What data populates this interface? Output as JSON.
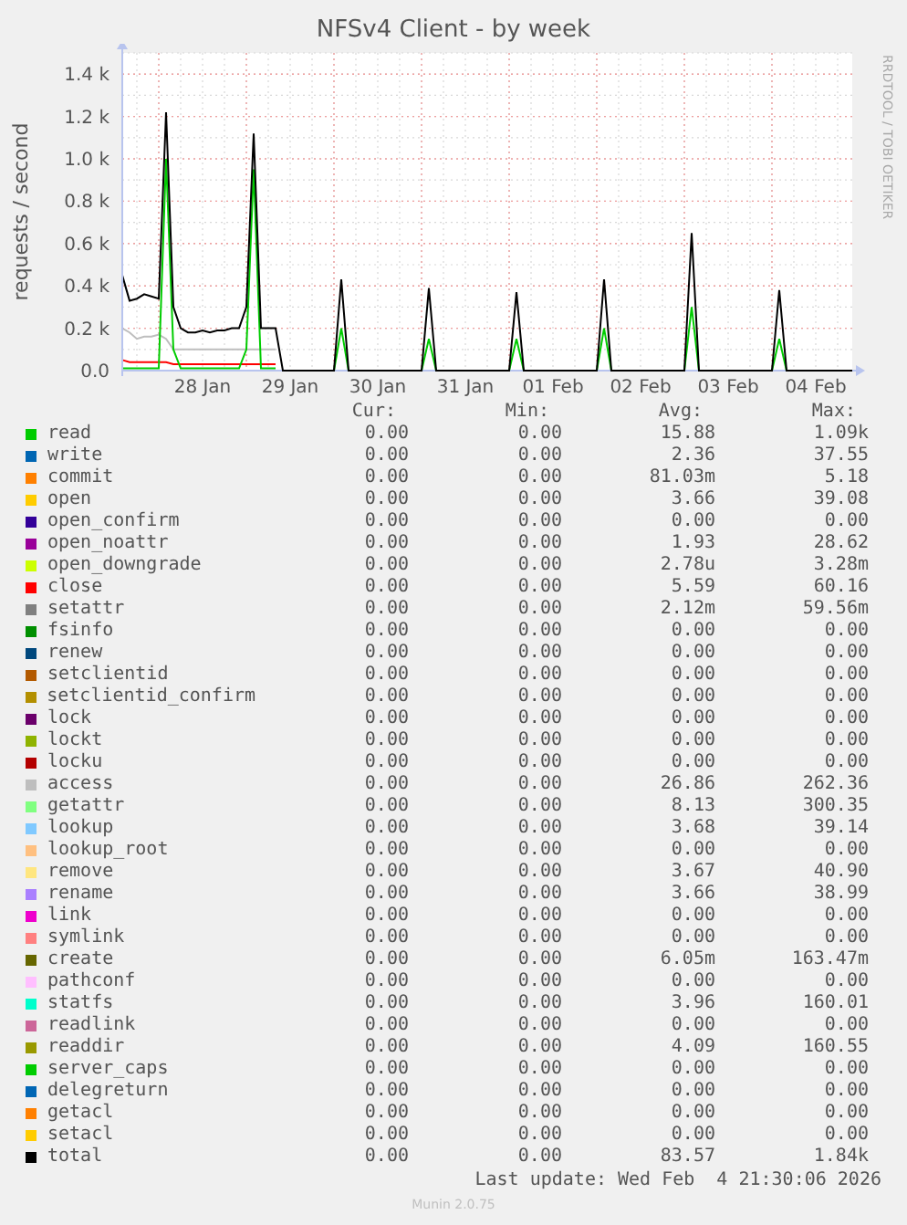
{
  "title": "NFSv4 Client - by week",
  "credit": "RRDTOOL / TOBI OETIKER",
  "chart_data": {
    "type": "line",
    "grid": true,
    "ylabel": "requests / second",
    "ylim": [
      0,
      1500
    ],
    "categories": [
      null,
      null,
      null,
      null,
      null,
      null,
      null,
      null,
      null,
      null,
      null,
      "28 Jan",
      null,
      null,
      null,
      null,
      null,
      null,
      null,
      null,
      null,
      null,
      null,
      "29 Jan",
      null,
      null,
      null,
      null,
      null,
      null,
      null,
      null,
      null,
      null,
      null,
      "30 Jan",
      null,
      null,
      null,
      null,
      null,
      null,
      null,
      null,
      null,
      null,
      null,
      "31 Jan",
      null,
      null,
      null,
      null,
      null,
      null,
      null,
      null,
      null,
      null,
      null,
      "01 Feb",
      null,
      null,
      null,
      null,
      null,
      null,
      null,
      null,
      null,
      null,
      null,
      "02 Feb",
      null,
      null,
      null,
      null,
      null,
      null,
      null,
      null,
      null,
      null,
      null,
      "03 Feb",
      null,
      null,
      null,
      null,
      null,
      null,
      null,
      null,
      null,
      null,
      null,
      "04 Feb",
      null,
      null,
      null,
      null,
      null
    ],
    "yticks": [
      {
        "value": 0,
        "label": "0.0"
      },
      {
        "value": 200,
        "label": "0.2 k"
      },
      {
        "value": 400,
        "label": "0.4 k"
      },
      {
        "value": 600,
        "label": "0.6 k"
      },
      {
        "value": 800,
        "label": "0.8 k"
      },
      {
        "value": 1000,
        "label": "1.0 k"
      },
      {
        "value": 1200,
        "label": "1.2 k"
      },
      {
        "value": 1400,
        "label": "1.4 k"
      }
    ],
    "series": [
      {
        "name": "access",
        "color": "#bebebe",
        "values": [
          200,
          180,
          150,
          160,
          160,
          170,
          150,
          100,
          100,
          100,
          100,
          100,
          100,
          100,
          100,
          100,
          100,
          100,
          100,
          100,
          100,
          100,
          null,
          null,
          null,
          null,
          null,
          null,
          null,
          null,
          null,
          null,
          null,
          null,
          null,
          null,
          null,
          null,
          null,
          null,
          null,
          null,
          null,
          null,
          null,
          null,
          null,
          null,
          null,
          null,
          null,
          null,
          null,
          null,
          null,
          null,
          null,
          null,
          null,
          null,
          null,
          null,
          null,
          null,
          null,
          null,
          null,
          null,
          null,
          null,
          null,
          null,
          null,
          null,
          null,
          null,
          null,
          null,
          null,
          null,
          null,
          null,
          null,
          null,
          null,
          null,
          null,
          null,
          null,
          null,
          null,
          null,
          null,
          null,
          null,
          null,
          null,
          null,
          null,
          null,
          null
        ]
      },
      {
        "name": "close",
        "color": "#ff0000",
        "values": [
          50,
          40,
          40,
          40,
          40,
          40,
          40,
          30,
          30,
          30,
          30,
          30,
          30,
          30,
          30,
          30,
          30,
          30,
          30,
          30,
          30,
          30,
          null,
          null,
          null,
          null,
          null,
          null,
          null,
          null,
          null,
          null,
          null,
          null,
          null,
          null,
          null,
          null,
          null,
          null,
          null,
          null,
          null,
          null,
          null,
          null,
          null,
          null,
          null,
          null,
          null,
          null,
          null,
          null,
          null,
          null,
          null,
          null,
          null,
          null,
          null,
          null,
          null,
          null,
          null,
          null,
          null,
          null,
          null,
          null,
          null,
          null,
          null,
          null,
          null,
          null,
          null,
          null,
          null,
          null,
          null,
          null,
          null,
          null,
          null,
          null,
          null,
          null,
          null,
          null,
          null,
          null,
          null,
          null,
          null,
          null,
          null,
          null,
          null,
          null,
          null
        ]
      },
      {
        "name": "read",
        "color": "#00cc00",
        "values": [
          10,
          10,
          10,
          10,
          10,
          10,
          1000,
          100,
          10,
          10,
          10,
          10,
          10,
          10,
          10,
          10,
          10,
          100,
          950,
          10,
          10,
          10,
          null,
          null,
          null,
          null,
          null,
          null,
          null,
          0,
          200,
          0,
          null,
          null,
          null,
          null,
          null,
          null,
          null,
          null,
          null,
          0,
          150,
          0,
          null,
          null,
          null,
          null,
          null,
          null,
          null,
          null,
          null,
          0,
          150,
          0,
          null,
          null,
          null,
          null,
          null,
          null,
          null,
          null,
          null,
          0,
          200,
          0,
          null,
          null,
          null,
          null,
          null,
          null,
          null,
          null,
          null,
          0,
          300,
          0,
          null,
          null,
          null,
          null,
          null,
          null,
          null,
          null,
          null,
          0,
          150,
          0,
          null,
          null,
          null,
          null,
          null,
          null,
          null,
          null,
          null
        ]
      },
      {
        "name": "total",
        "color": "#000000",
        "values": [
          450,
          330,
          340,
          360,
          350,
          340,
          1220,
          300,
          200,
          180,
          180,
          190,
          180,
          190,
          190,
          200,
          200,
          300,
          1120,
          200,
          200,
          200,
          0,
          0,
          0,
          0,
          0,
          0,
          0,
          0,
          430,
          0,
          0,
          0,
          0,
          0,
          0,
          0,
          0,
          0,
          0,
          0,
          390,
          0,
          0,
          0,
          0,
          0,
          0,
          0,
          0,
          0,
          0,
          0,
          370,
          0,
          0,
          0,
          0,
          0,
          0,
          0,
          0,
          0,
          0,
          0,
          430,
          0,
          0,
          0,
          0,
          0,
          0,
          0,
          0,
          0,
          0,
          0,
          650,
          0,
          0,
          0,
          0,
          0,
          0,
          0,
          0,
          0,
          0,
          0,
          380,
          0,
          0,
          0,
          0,
          0,
          0,
          0,
          0,
          0,
          0
        ]
      }
    ]
  },
  "legend_headers": [
    "Cur:",
    "Min:",
    "Avg:",
    "Max:"
  ],
  "legend": [
    {
      "kind": "series",
      "color": "#00cc00",
      "cur": "0.00",
      "min": "0.00",
      "avg": "15.88",
      "max": "1.09k"
    },
    {
      "name": "write",
      "color": "#0066b3",
      "cur": "0.00",
      "min": "0.00",
      "avg": "2.36",
      "max": "37.55"
    },
    {
      "name": "commit",
      "color": "#ff8000",
      "cur": "0.00",
      "min": "0.00",
      "avg": "81.03m",
      "max": "5.18"
    },
    {
      "name": "open",
      "color": "#ffcc00",
      "cur": "0.00",
      "min": "0.00",
      "avg": "3.66",
      "max": "39.08"
    },
    {
      "name": "open_confirm",
      "color": "#330099",
      "cur": "0.00",
      "min": "0.00",
      "avg": "0.00",
      "max": "0.00"
    },
    {
      "name": "open_noattr",
      "color": "#990099",
      "cur": "0.00",
      "min": "0.00",
      "avg": "1.93",
      "max": "28.62"
    },
    {
      "name": "open_downgrade",
      "color": "#ccff00",
      "cur": "0.00",
      "min": "0.00",
      "avg": "2.78u",
      "max": "3.28m"
    },
    {
      "kind": "series",
      "color": "#ff0000",
      "cur": "0.00",
      "min": "0.00",
      "avg": "5.59",
      "max": "60.16"
    },
    {
      "name": "setattr",
      "color": "#808080",
      "cur": "0.00",
      "min": "0.00",
      "avg": "2.12m",
      "max": "59.56m"
    },
    {
      "name": "fsinfo",
      "color": "#008f00",
      "cur": "0.00",
      "min": "0.00",
      "avg": "0.00",
      "max": "0.00"
    },
    {
      "name": "renew",
      "color": "#00487d",
      "cur": "0.00",
      "min": "0.00",
      "avg": "0.00",
      "max": "0.00"
    },
    {
      "name": "setclientid",
      "color": "#b35a00",
      "cur": "0.00",
      "min": "0.00",
      "avg": "0.00",
      "max": "0.00"
    },
    {
      "name": "setclientid_confirm",
      "color": "#b38f00",
      "cur": "0.00",
      "min": "0.00",
      "avg": "0.00",
      "max": "0.00"
    },
    {
      "name": "lock",
      "color": "#6b006b",
      "cur": "0.00",
      "min": "0.00",
      "avg": "0.00",
      "max": "0.00"
    },
    {
      "name": "lockt",
      "color": "#8fb300",
      "cur": "0.00",
      "min": "0.00",
      "avg": "0.00",
      "max": "0.00"
    },
    {
      "name": "locku",
      "color": "#b30000",
      "cur": "0.00",
      "min": "0.00",
      "avg": "0.00",
      "max": "0.00"
    },
    {
      "kind": "series",
      "color": "#bebebe",
      "cur": "0.00",
      "min": "0.00",
      "avg": "26.86",
      "max": "262.36"
    },
    {
      "name": "getattr",
      "color": "#80ff80",
      "cur": "0.00",
      "min": "0.00",
      "avg": "8.13",
      "max": "300.35"
    },
    {
      "name": "lookup",
      "color": "#80c9ff",
      "cur": "0.00",
      "min": "0.00",
      "avg": "3.68",
      "max": "39.14"
    },
    {
      "name": "lookup_root",
      "color": "#ffc080",
      "cur": "0.00",
      "min": "0.00",
      "avg": "0.00",
      "max": "0.00"
    },
    {
      "name": "remove",
      "color": "#ffe680",
      "cur": "0.00",
      "min": "0.00",
      "avg": "3.67",
      "max": "40.90"
    },
    {
      "name": "rename",
      "color": "#aa80ff",
      "cur": "0.00",
      "min": "0.00",
      "avg": "3.66",
      "max": "38.99"
    },
    {
      "name": "link",
      "color": "#ee00cc",
      "cur": "0.00",
      "min": "0.00",
      "avg": "0.00",
      "max": "0.00"
    },
    {
      "name": "symlink",
      "color": "#ff8080",
      "cur": "0.00",
      "min": "0.00",
      "avg": "0.00",
      "max": "0.00"
    },
    {
      "name": "create",
      "color": "#666600",
      "cur": "0.00",
      "min": "0.00",
      "avg": "6.05m",
      "max": "163.47m"
    },
    {
      "name": "pathconf",
      "color": "#ffbfff",
      "cur": "0.00",
      "min": "0.00",
      "avg": "0.00",
      "max": "0.00"
    },
    {
      "name": "statfs",
      "color": "#00ffcc",
      "cur": "0.00",
      "min": "0.00",
      "avg": "3.96",
      "max": "160.01"
    },
    {
      "name": "readlink",
      "color": "#cc6699",
      "cur": "0.00",
      "min": "0.00",
      "avg": "0.00",
      "max": "0.00"
    },
    {
      "name": "readdir",
      "color": "#999900",
      "cur": "0.00",
      "min": "0.00",
      "avg": "4.09",
      "max": "160.55"
    },
    {
      "name": "server_caps",
      "color": "#00cc01",
      "cur": "0.00",
      "min": "0.00",
      "avg": "0.00",
      "max": "0.00"
    },
    {
      "name": "delegreturn",
      "color": "#0066b4",
      "cur": "0.00",
      "min": "0.00",
      "avg": "0.00",
      "max": "0.00"
    },
    {
      "name": "getacl",
      "color": "#ff8001",
      "cur": "0.00",
      "min": "0.00",
      "avg": "0.00",
      "max": "0.00"
    },
    {
      "name": "setacl",
      "color": "#ffcc01",
      "cur": "0.00",
      "min": "0.00",
      "avg": "0.00",
      "max": "0.00"
    },
    {
      "kind": "series",
      "color": "#000000",
      "cur": "0.00",
      "min": "0.00",
      "avg": "83.57",
      "max": "1.84k"
    }
  ],
  "last_update": "Last update: Wed Feb  4 21:30:06 2026",
  "version": "Munin 2.0.75"
}
